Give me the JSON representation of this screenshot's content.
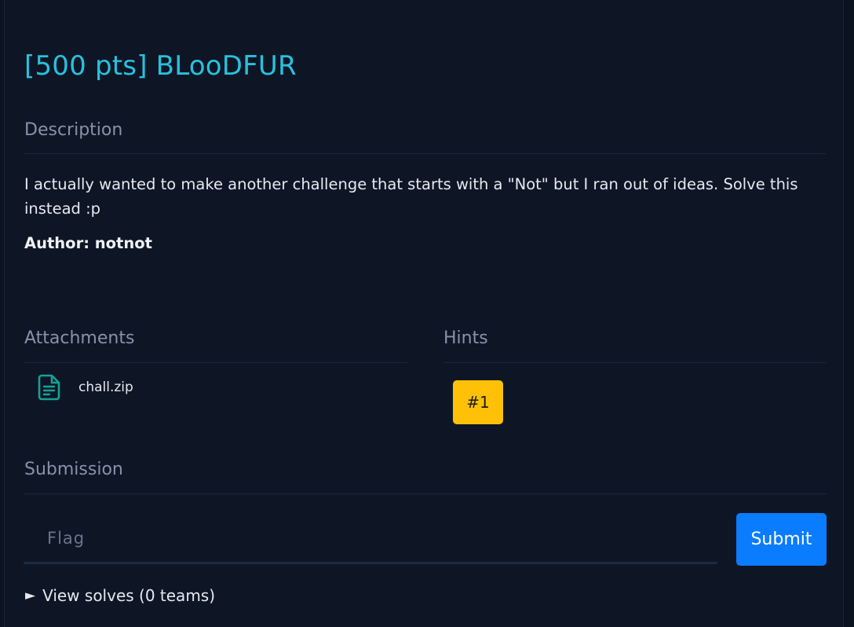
{
  "challenge": {
    "title": "[500 pts] BLooDFUR"
  },
  "description": {
    "heading": "Description",
    "text": "I actually wanted to make another challenge that starts with a \"Not\" but I ran out of ideas. Solve this instead :p",
    "author": "Author: notnot"
  },
  "attachments": {
    "heading": "Attachments",
    "files": [
      {
        "name": "chall.zip",
        "icon": "file-document-icon"
      }
    ],
    "icon_color": "#14a294"
  },
  "hints": {
    "heading": "Hints",
    "items": [
      {
        "label": "#1"
      }
    ],
    "button_color": "#ffc107"
  },
  "submission": {
    "heading": "Submission",
    "placeholder": "Flag",
    "value": "",
    "submit_label": "Submit",
    "submit_color": "#0a7cff"
  },
  "solves": {
    "label": "View solves (0 teams)",
    "icon": "triangle-right-icon"
  },
  "colors": {
    "title": "#29c1dd",
    "background": "#0e1626"
  }
}
